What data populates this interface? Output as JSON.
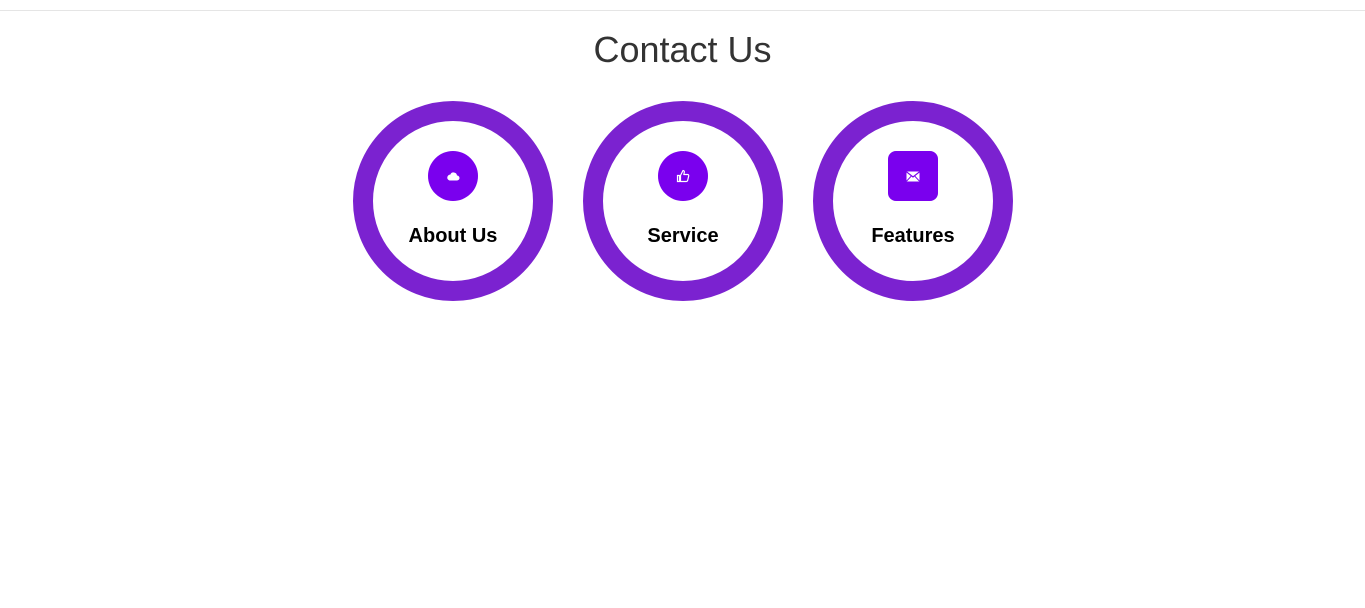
{
  "page": {
    "title": "Contact Us"
  },
  "theme": {
    "ring_color": "#7b22d0",
    "icon_bg_color": "#7a00ee",
    "title_color": "#333333",
    "label_color": "#000000"
  },
  "cards": [
    {
      "label": "About Us",
      "icon": "cloud-icon",
      "icon_shape": "circle"
    },
    {
      "label": "Service",
      "icon": "thumbs-up-icon",
      "icon_shape": "circle"
    },
    {
      "label": "Features",
      "icon": "envelope-icon",
      "icon_shape": "rounded-square"
    }
  ]
}
